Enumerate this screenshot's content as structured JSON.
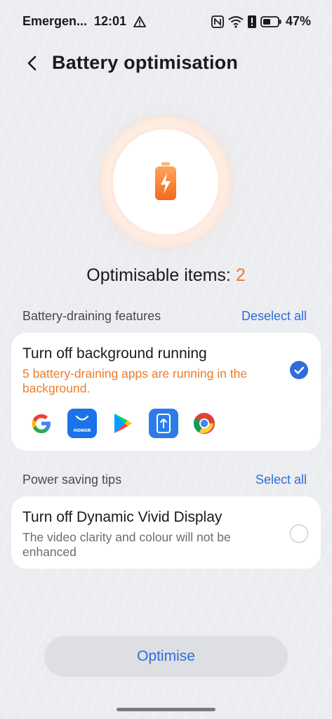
{
  "status_bar": {
    "carrier": "Emergen...",
    "time": "12:01",
    "battery_percent": "47%",
    "icons": [
      "warning-icon",
      "nfc-icon",
      "wifi-icon",
      "alert-icon",
      "battery-icon"
    ]
  },
  "header": {
    "title": "Battery optimisation"
  },
  "summary": {
    "label": "Optimisable items: ",
    "count": "2"
  },
  "draining": {
    "section_title": "Battery-draining features",
    "action": "Deselect all",
    "item_title": "Turn off background running",
    "item_desc": "5 battery-draining apps are running in the background.",
    "checked": true,
    "apps": [
      "google-icon",
      "honor-store-icon",
      "play-store-icon",
      "phone-clone-icon",
      "chrome-icon"
    ]
  },
  "tips": {
    "section_title": "Power saving tips",
    "action": "Select all",
    "item_title": "Turn off Dynamic Vivid Display",
    "item_desc": "The video clarity and colour will not be enhanced",
    "checked": false
  },
  "footer": {
    "button_label": "Optimise"
  },
  "colors": {
    "accent": "#2f6bdb",
    "warning": "#f07a2a",
    "background": "#ecedf0"
  }
}
